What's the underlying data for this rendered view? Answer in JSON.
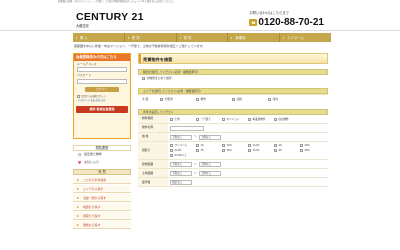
{
  "top_strip": "首都圏の新築・中古マンション、一戸建て、土地の不動産情報はセンチュリー21大蔵住宅にお任せください。",
  "logo": {
    "brand": "CENTURY 21",
    "sub": "大蔵住宅"
  },
  "contact": {
    "label": "お問い合わせはこちらまで",
    "phone": "0120-88-70-21",
    "phone_icon": "freedial-icon"
  },
  "nav": [
    "購 入",
    "売 却",
    "賃 貸",
    "事業用",
    "リフォーム"
  ],
  "tagline": "首都圏を中心に新築・中古マンション、一戸建て、土地の不動産情報を幅広くご紹介しています。",
  "login": {
    "header": "会員登録済みの方はこちら",
    "email_label": "メールアドレス",
    "password_label": "パスワード",
    "button": "ログイン",
    "remember": "次回から自動ログイン",
    "forgot": "パスワードをお忘れの方",
    "register_button": "無料 新規会員登録"
  },
  "history": {
    "header": "閲覧履歴",
    "items": [
      {
        "icon": "clock-icon",
        "label": "最近見た物件"
      },
      {
        "icon": "heart-icon",
        "label": "お気に入り"
      }
    ]
  },
  "buy_menu": {
    "header": "売 買",
    "items": [
      "こだわり条件検索",
      "エリアから探す",
      "沿線・駅から探す",
      "地図から探す",
      "間取りで探す",
      "価格から探す"
    ]
  },
  "main": {
    "title": "売買物件を検索",
    "sec1": "種別を選択してください(必須・複数選択可)",
    "sec1_option": "全種別まとめて検索",
    "sec2": "エリアを選択してください(必須・複数選択可)",
    "area_label": "大 阪",
    "areas": [
      "大阪市",
      "堺市",
      "北摂",
      "河内"
    ],
    "sec3": "条件を設定してください",
    "form": [
      {
        "label": "物件種別",
        "options": [
          "土地",
          "一戸建て",
          "マンション",
          "事業用物件",
          "収益物件"
        ]
      },
      {
        "label": "物件名称",
        "input": true
      },
      {
        "label": "価 格",
        "select_from": "下限なし",
        "tilde": "〜",
        "select_to": "上限なし"
      },
      {
        "label": "間取り",
        "options": [
          "ワンルーム",
          "1K",
          "1DK",
          "1LDK",
          "2K",
          "2DK",
          "2LDK",
          "3K",
          "3DK",
          "3LDK",
          "4K",
          "4DK",
          "4LDK以上"
        ]
      },
      {
        "label": "建物面積",
        "select_from": "下限なし",
        "tilde": "〜",
        "select_to": "上限なし"
      },
      {
        "label": "土地面積",
        "select_from": "下限なし",
        "tilde": "〜",
        "select_to": "上限なし"
      },
      {
        "label": "築年数",
        "select_from": "指定なし"
      }
    ]
  },
  "colors": {
    "nav": "#c5a64a",
    "accent_orange": "#e8752a",
    "register_red": "#c73a20",
    "section_bar": "#e7db8c"
  }
}
